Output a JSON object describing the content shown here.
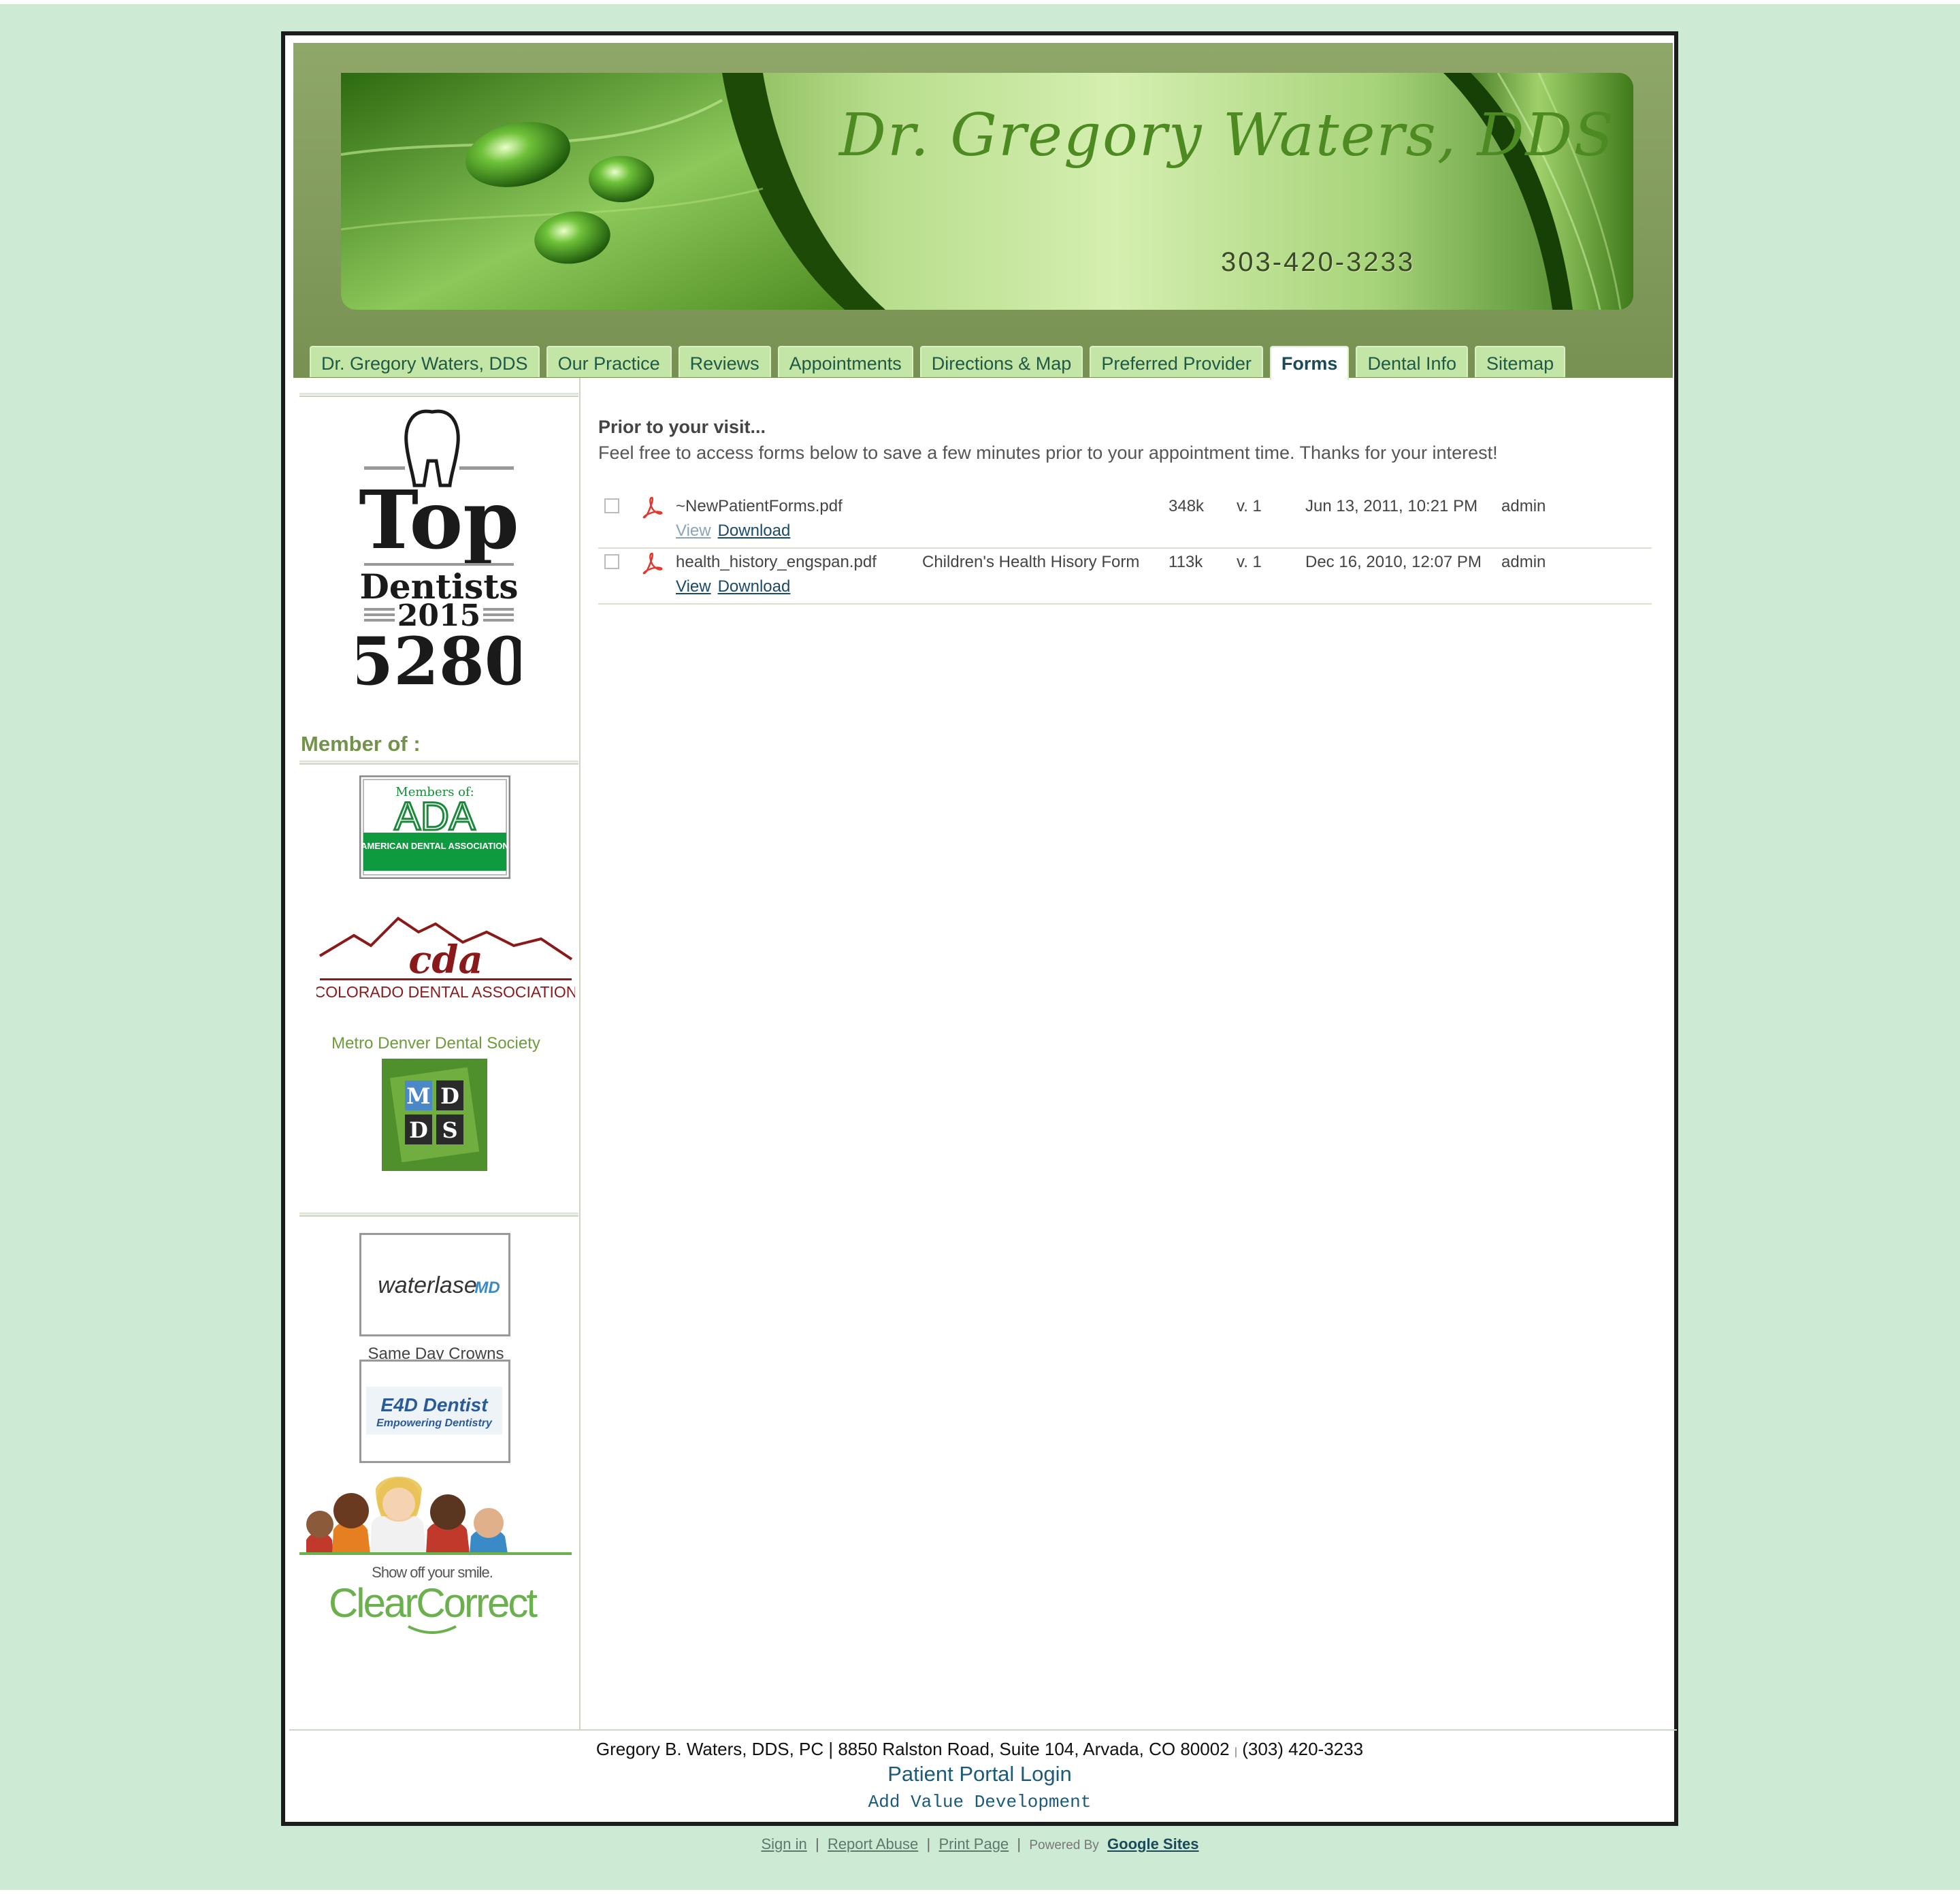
{
  "header": {
    "banner_title": "Dr. Gregory Waters, DDS",
    "banner_phone": "303-420-3233"
  },
  "nav": {
    "tabs": [
      {
        "label": "Dr. Gregory Waters, DDS"
      },
      {
        "label": "Our Practice"
      },
      {
        "label": "Reviews"
      },
      {
        "label": "Appointments"
      },
      {
        "label": "Directions & Map"
      },
      {
        "label": "Preferred Provider"
      },
      {
        "label": "Forms",
        "active": true
      },
      {
        "label": "Dental Info"
      },
      {
        "label": "Sitemap"
      }
    ]
  },
  "sidebar": {
    "top_dentists": {
      "top": "Top",
      "dentists": "Dentists",
      "year": "2015",
      "num": "5280"
    },
    "member_title": "Member of :",
    "ada": {
      "members_of": "Members of:",
      "abbr": "ADA",
      "name": "AMERICAN DENTAL ASSOCIATION"
    },
    "cda": {
      "script": "cda",
      "name": "COLORADO DENTAL ASSOCIATION"
    },
    "mdds": {
      "caption": "Metro Denver Dental Society",
      "letters": [
        "M",
        "D",
        "D",
        "S"
      ]
    },
    "waterlase": {
      "text": "waterlase",
      "suffix": "MD"
    },
    "crowns_caption": "Same Day Crowns",
    "e4d": {
      "text": "E4D Dentist",
      "tagline": "Empowering Dentistry"
    },
    "clearcorrect": {
      "tagline": "Show off your smile.",
      "brand": "ClearCorrect"
    }
  },
  "main": {
    "heading": "Prior to your visit...",
    "intro": "Feel free to access forms below to save a few minutes prior to your appointment time.  Thanks for your interest!",
    "files": [
      {
        "name": "~NewPatientForms.pdf",
        "description": "",
        "size": "348k",
        "version": "v. 1",
        "date": "Jun 13, 2011, 10:21 PM",
        "user": "admin",
        "view": "View",
        "download": "Download"
      },
      {
        "name": "health_history_engspan.pdf",
        "description": "Children's Health Hisory Form",
        "size": "113k",
        "version": "v. 1",
        "date": "Dec 16, 2010, 12:07 PM",
        "user": "admin",
        "view": "View",
        "download": "Download"
      }
    ]
  },
  "footer": {
    "address": "Gregory B. Waters, DDS, PC | 8850 Ralston Road, Suite 104, Arvada, CO 80002",
    "separator": "|",
    "phone": "(303) 420-3233",
    "portal": "Patient Portal Login",
    "developer": "Add Value Development"
  },
  "bottombar": {
    "sign_in": "Sign in",
    "report_abuse": "Report Abuse",
    "print_page": "Print Page",
    "powered_by": "Powered By",
    "google_sites": "Google Sites",
    "sep": "|"
  },
  "colors": {
    "page_bg": "#cdebd4",
    "header_green": "#7f9a5a",
    "tab_bg": "#c3e5a5",
    "link": "#1a4a6a"
  }
}
